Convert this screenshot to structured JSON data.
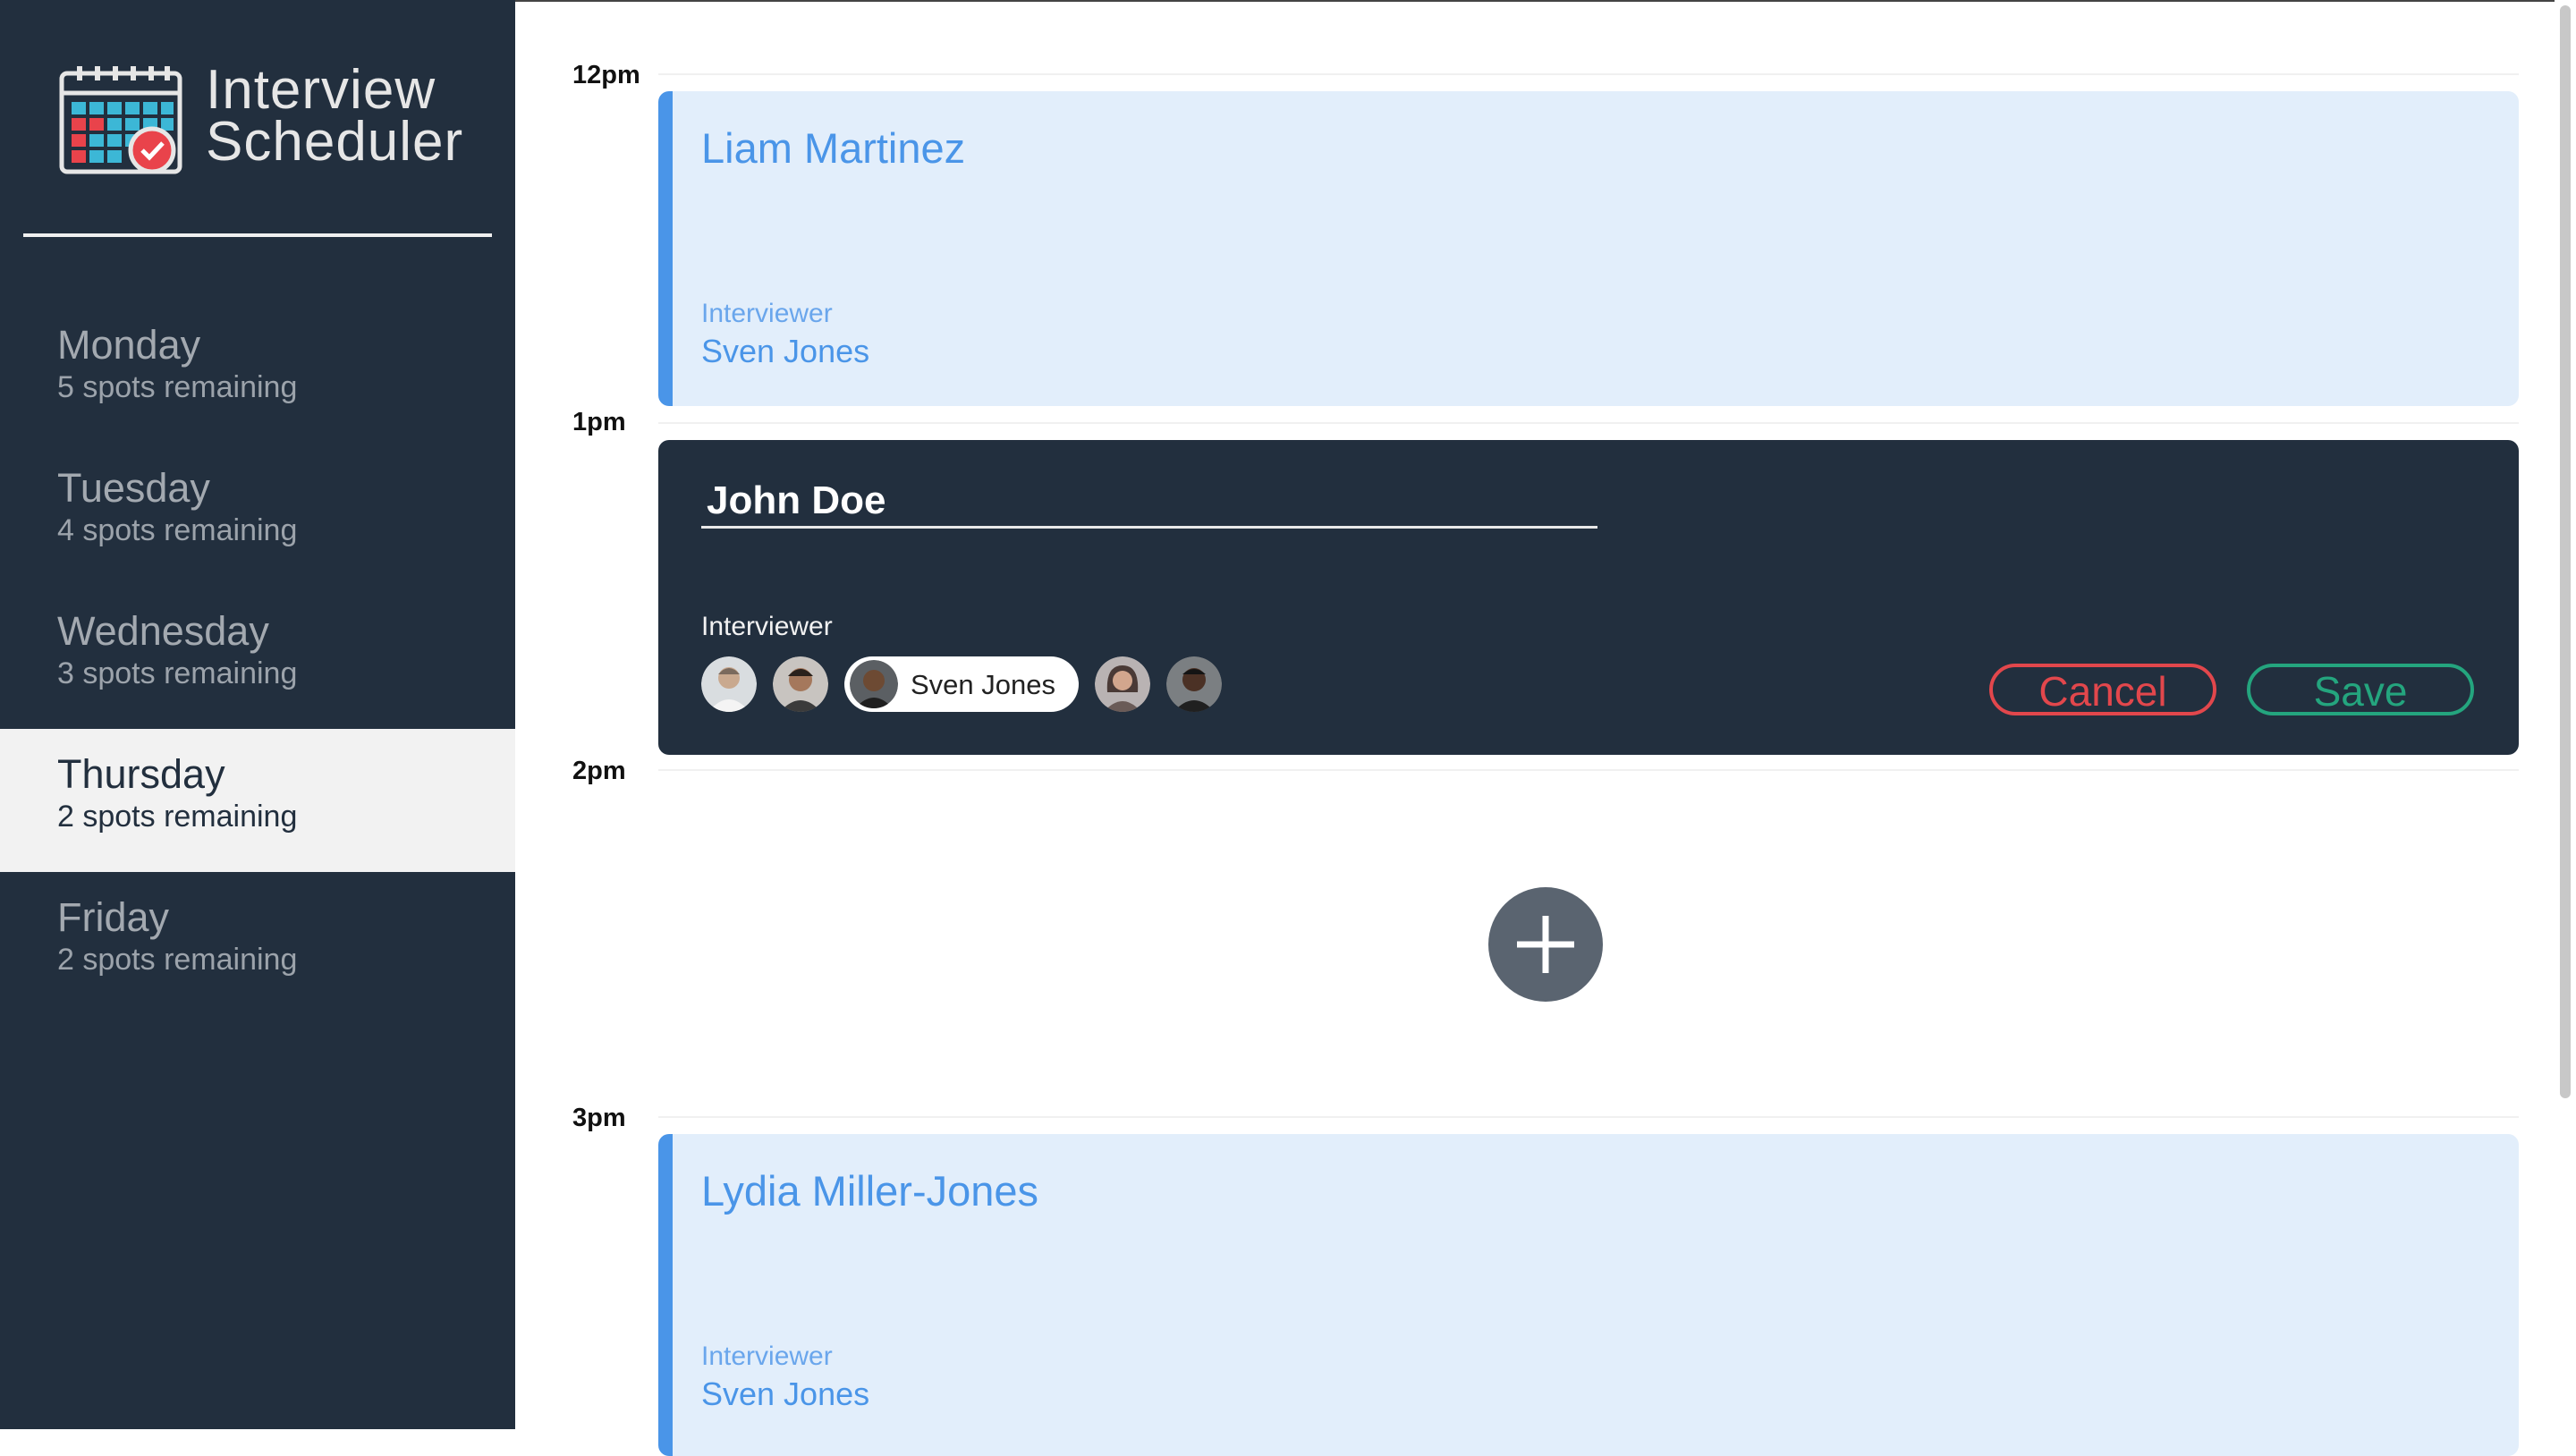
{
  "app": {
    "title_line1": "Interview",
    "title_line2": "Scheduler",
    "logo_icon": "calendar-check-icon"
  },
  "colors": {
    "sidebar_bg": "#222f3e",
    "appointment_bg": "#e2eefb",
    "appointment_accent": "#4a95e8",
    "cancel": "#e2474c",
    "save": "#24a57e",
    "add_button": "#5a6470"
  },
  "days": [
    {
      "name": "Monday",
      "spots": "5 spots remaining",
      "selected": false
    },
    {
      "name": "Tuesday",
      "spots": "4 spots remaining",
      "selected": false
    },
    {
      "name": "Wednesday",
      "spots": "3 spots remaining",
      "selected": false
    },
    {
      "name": "Thursday",
      "spots": "2 spots remaining",
      "selected": true
    },
    {
      "name": "Friday",
      "spots": "2 spots remaining",
      "selected": false
    }
  ],
  "schedule": {
    "times": [
      "12pm",
      "1pm",
      "2pm",
      "3pm"
    ],
    "appointments": [
      {
        "student": "Liam Martinez",
        "interviewer_label": "Interviewer",
        "interviewer": "Sven Jones"
      },
      {
        "student": "Lydia Miller-Jones",
        "interviewer_label": "Interviewer",
        "interviewer": "Sven Jones"
      }
    ],
    "add_icon": "plus-icon"
  },
  "form": {
    "student_value": "John Doe",
    "interviewer_label": "Interviewer",
    "selected_interviewer": "Sven Jones",
    "avatar_count": 5,
    "cancel_label": "Cancel",
    "save_label": "Save"
  }
}
